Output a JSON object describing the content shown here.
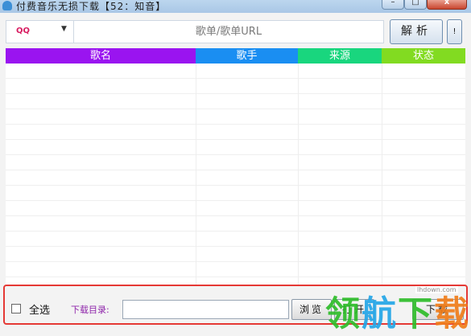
{
  "window": {
    "title": "付费音乐无损下载【52：知音】"
  },
  "titlebar_buttons": {
    "minimize": "–",
    "maximize": "□",
    "close": "x"
  },
  "toolbar": {
    "source_value": "QQ",
    "url_placeholder": "歌单/歌单URL",
    "parse_label": "解析",
    "info_label": "!"
  },
  "table": {
    "columns": [
      "歌名",
      "歌手",
      "来源",
      "状态"
    ],
    "column_colors": [
      "#9a14f0",
      "#1a8ef2",
      "#19d67e",
      "#82db21"
    ],
    "rows": []
  },
  "bottom": {
    "select_all_label": "全选",
    "select_all_checked": false,
    "dir_label": "下载目录:",
    "dir_value": "",
    "browse_label": "浏览",
    "open_label": "打开",
    "download_label": "下载"
  },
  "watermark": {
    "logo": "领航下载",
    "url": "lhdown.com"
  }
}
